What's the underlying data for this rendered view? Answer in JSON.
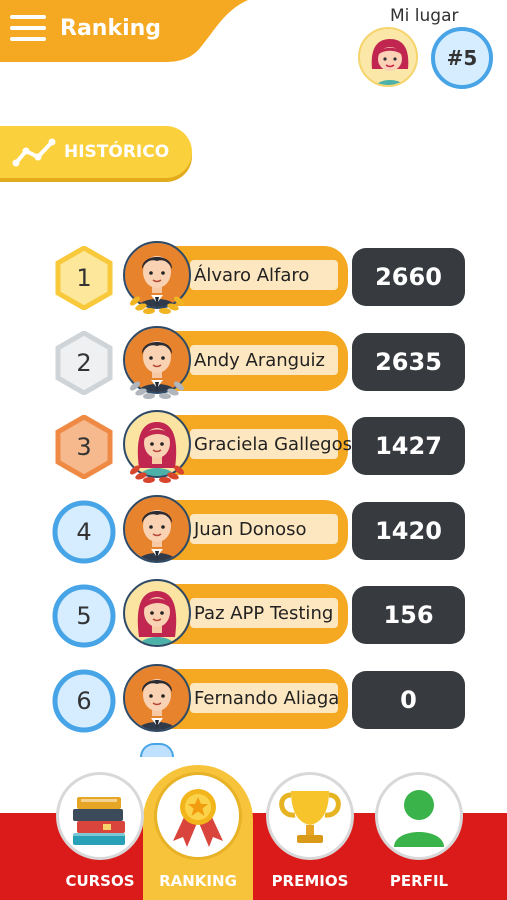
{
  "header": {
    "title": "Ranking",
    "my_place_label": "Mi lugar",
    "my_rank": "#5"
  },
  "history_button": {
    "label": "HISTÓRICO"
  },
  "ranking": [
    {
      "position": "1",
      "name": "Álvaro Alfaro",
      "score": "2660",
      "medal": "gold",
      "avatar": "boy"
    },
    {
      "position": "2",
      "name": "Andy Aranguiz",
      "score": "2635",
      "medal": "silver",
      "avatar": "boy"
    },
    {
      "position": "3",
      "name": "Graciela Gallegos",
      "score": "1427",
      "medal": "bronze",
      "avatar": "girl"
    },
    {
      "position": "4",
      "name": "Juan Donoso",
      "score": "1420",
      "medal": "blue",
      "avatar": "boy"
    },
    {
      "position": "5",
      "name": "Paz APP Testing",
      "score": "156",
      "medal": "blue",
      "avatar": "girl"
    },
    {
      "position": "6",
      "name": "Fernando Aliaga",
      "score": "0",
      "medal": "blue",
      "avatar": "boy"
    }
  ],
  "bottom_nav": [
    {
      "label": "CURSOS",
      "icon": "books-icon",
      "active": false
    },
    {
      "label": "RANKING",
      "icon": "ribbon-medal-icon",
      "active": true
    },
    {
      "label": "PREMIOS",
      "icon": "trophy-icon",
      "active": false
    },
    {
      "label": "PERFIL",
      "icon": "user-profile-icon",
      "active": false
    }
  ],
  "colors": {
    "accent_orange": "#f5a821",
    "accent_yellow": "#fbd03d",
    "score_bg": "#373b40",
    "nav_red": "#db1a1a",
    "rank_blue": "#47a4e6"
  }
}
